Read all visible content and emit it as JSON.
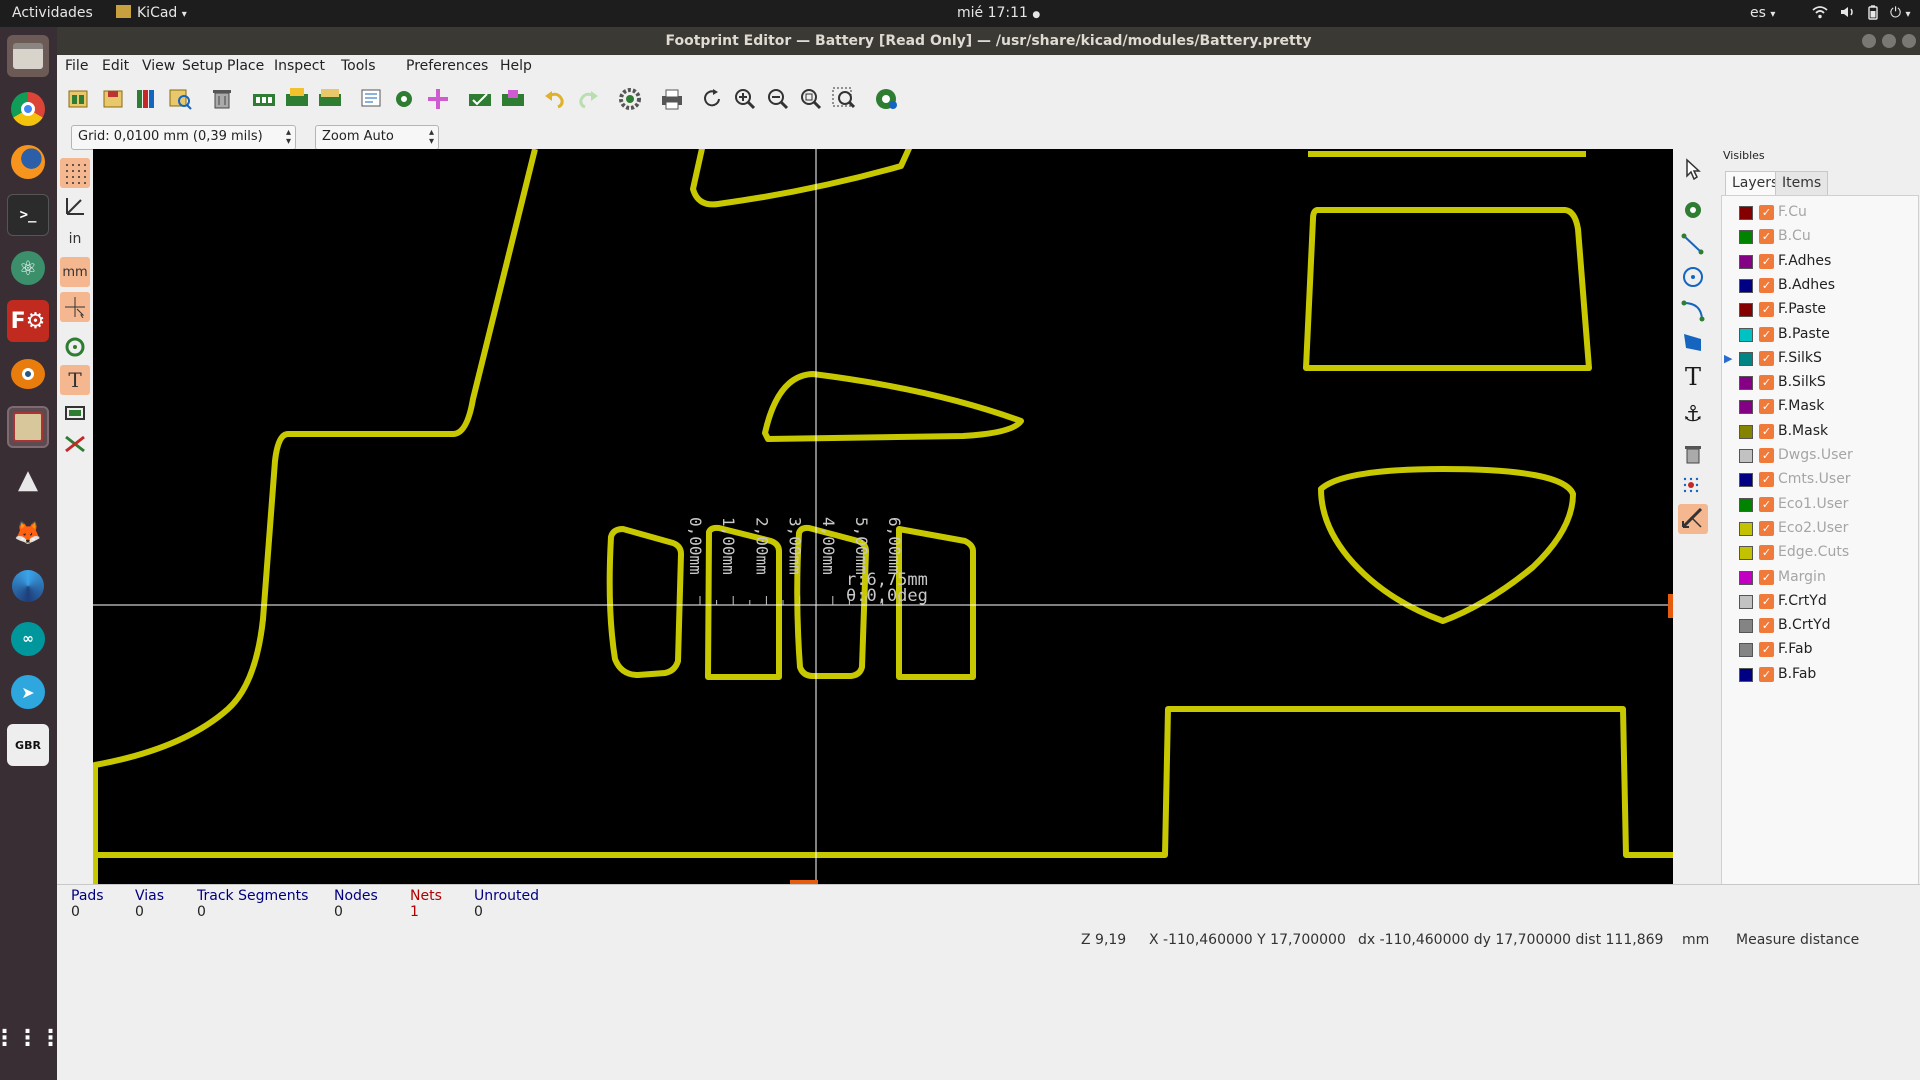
{
  "topbar": {
    "activities": "Actividades",
    "app_menu": "KiCad",
    "clock": "mié 17:11",
    "lang": "es"
  },
  "window": {
    "title": "Footprint Editor — Battery [Read Only] — /usr/share/kicad/modules/Battery.pretty"
  },
  "menubar": [
    "File",
    "Edit",
    "View",
    "Setup",
    "Place",
    "Inspect",
    "Tools",
    "Preferences",
    "Help"
  ],
  "options": {
    "grid": "Grid: 0,0100 mm (0,39 mils)",
    "zoom": "Zoom Auto"
  },
  "left_toolbar_labels": {
    "inch": "in",
    "mm": "mm"
  },
  "canvas": {
    "measure_radius": "r:6,75mm",
    "measure_angle": "θ:0,0deg",
    "ruler_labels": [
      "0,00mm",
      "1,00mm",
      "2,00mm",
      "3,00mm",
      "4,00mm",
      "5,00mm",
      "6,00mm"
    ],
    "outline_color": "#c8c800",
    "background": "#000000"
  },
  "visibles": {
    "title": "Visibles",
    "tabs": [
      "Layers",
      "Items"
    ],
    "layers": [
      {
        "name": "F.Cu",
        "color": "#840000",
        "dim": true
      },
      {
        "name": "B.Cu",
        "color": "#008400",
        "dim": true
      },
      {
        "name": "F.Adhes",
        "color": "#840084",
        "dim": false
      },
      {
        "name": "B.Adhes",
        "color": "#000084",
        "dim": false
      },
      {
        "name": "F.Paste",
        "color": "#840000",
        "dim": false
      },
      {
        "name": "B.Paste",
        "color": "#00c2c2",
        "dim": false
      },
      {
        "name": "F.SilkS",
        "color": "#008484",
        "dim": false,
        "current": true
      },
      {
        "name": "B.SilkS",
        "color": "#840084",
        "dim": false
      },
      {
        "name": "F.Mask",
        "color": "#840084",
        "dim": false
      },
      {
        "name": "B.Mask",
        "color": "#848400",
        "dim": false
      },
      {
        "name": "Dwgs.User",
        "color": "#c2c2c2",
        "dim": true
      },
      {
        "name": "Cmts.User",
        "color": "#000084",
        "dim": true
      },
      {
        "name": "Eco1.User",
        "color": "#008400",
        "dim": true
      },
      {
        "name": "Eco2.User",
        "color": "#c2c200",
        "dim": true
      },
      {
        "name": "Edge.Cuts",
        "color": "#c2c200",
        "dim": true
      },
      {
        "name": "Margin",
        "color": "#c200c2",
        "dim": true
      },
      {
        "name": "F.CrtYd",
        "color": "#c2c2c2",
        "dim": false
      },
      {
        "name": "B.CrtYd",
        "color": "#848484",
        "dim": false
      },
      {
        "name": "F.Fab",
        "color": "#848484",
        "dim": false
      },
      {
        "name": "B.Fab",
        "color": "#000084",
        "dim": false
      }
    ]
  },
  "messages": [
    {
      "title": "Pads",
      "value": "0",
      "color": "#00007f"
    },
    {
      "title": "Vias",
      "value": "0",
      "color": "#00007f"
    },
    {
      "title": "Track Segments",
      "value": "0",
      "color": "#00007f"
    },
    {
      "title": "Nodes",
      "value": "0",
      "color": "#00007f"
    },
    {
      "title": "Nets",
      "value": "1",
      "color": "#b20000"
    },
    {
      "title": "Unrouted",
      "value": "0",
      "color": "#00007f"
    }
  ],
  "status": {
    "zoom": "Z 9,19",
    "xy": "X -110,460000  Y 17,700000",
    "dxy": "dx -110,460000  dy 17,700000  dist 111,869",
    "units": "mm",
    "mode": "Measure distance"
  }
}
